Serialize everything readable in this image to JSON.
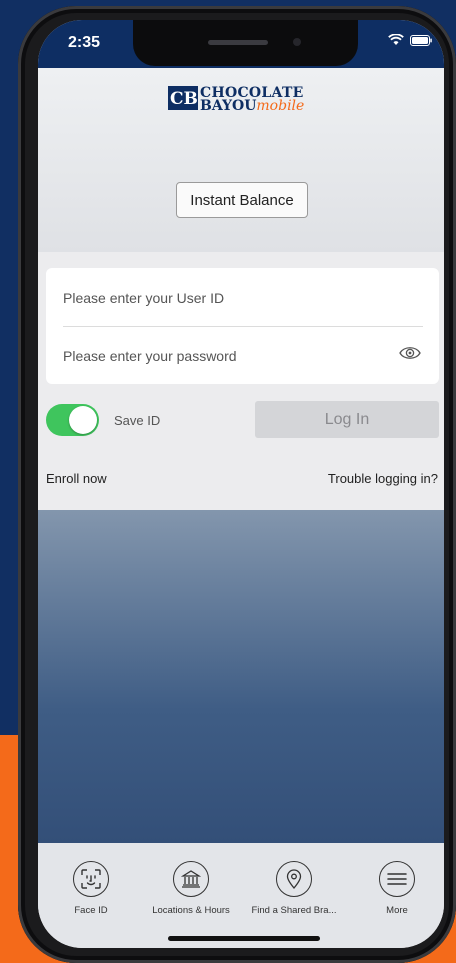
{
  "status": {
    "time": "2:35"
  },
  "brand": {
    "line1": "CHOCOLATE",
    "line2": "BAYOU",
    "line2_suffix": "mobile",
    "mark": "CB"
  },
  "header": {
    "instant_balance_label": "Instant Balance"
  },
  "login": {
    "user_id_placeholder": "Please enter your User ID",
    "password_placeholder": "Please enter your password",
    "save_id_label": "Save ID",
    "save_id_on": true,
    "login_button_label": "Log In",
    "enroll_label": "Enroll now",
    "trouble_label": "Trouble logging in?"
  },
  "tabbar": {
    "items": [
      {
        "label": "Face ID",
        "icon": "face-id-icon"
      },
      {
        "label": "Locations & Hours",
        "icon": "bank-icon"
      },
      {
        "label": "Find a Shared Bra...",
        "icon": "location-pin-icon"
      },
      {
        "label": "More",
        "icon": "menu-icon"
      }
    ]
  },
  "colors": {
    "navy": "#0e2e63",
    "orange": "#f46a1a",
    "toggle_on": "#3fc55d"
  }
}
